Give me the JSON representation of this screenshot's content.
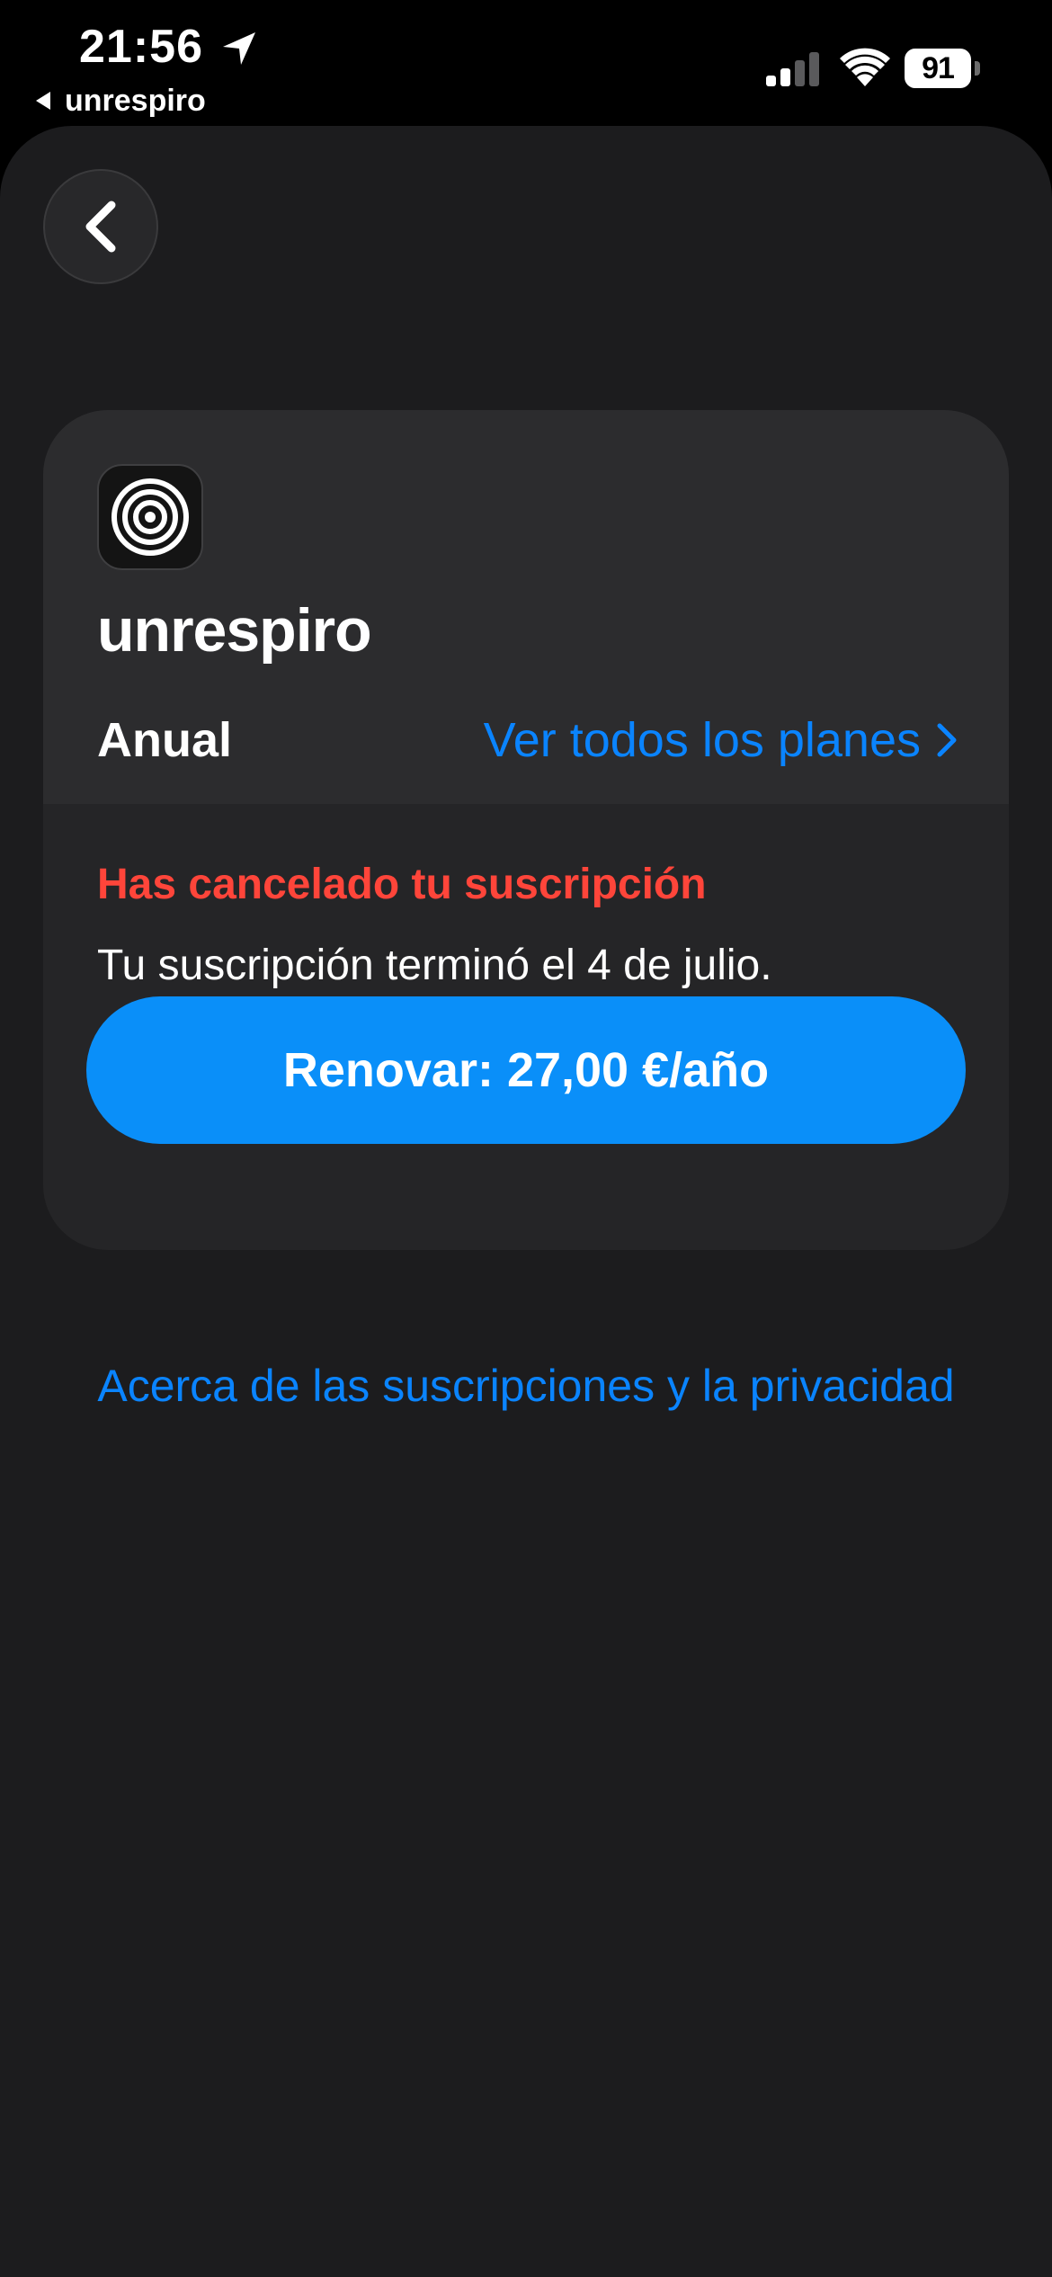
{
  "status_bar": {
    "time": "21:56",
    "back_app_label": "unrespiro",
    "battery_level": "91",
    "icons": [
      "location-arrow-icon",
      "cellular-signal-icon",
      "wifi-icon",
      "battery-icon"
    ]
  },
  "navigation": {
    "back_icon": "chevron-left-icon"
  },
  "subscription": {
    "app_icon": "concentric-circles-icon",
    "app_name": "unrespiro",
    "plan": "Anual",
    "plans_link": "Ver todos los planes",
    "status_title": "Has cancelado tu suscripción",
    "status_message": "Tu suscripción terminó el 4 de julio.",
    "renew_button": "Renovar: 27,00 €/año"
  },
  "footer": {
    "about_link": "Acerca de las suscripciones y la privacidad"
  },
  "colors": {
    "background": "#1c1c1e",
    "card_top": "#2c2c2e",
    "card_bottom": "#252527",
    "link": "#0a84ff",
    "button": "#0a8ff9",
    "error": "#ff453a"
  }
}
